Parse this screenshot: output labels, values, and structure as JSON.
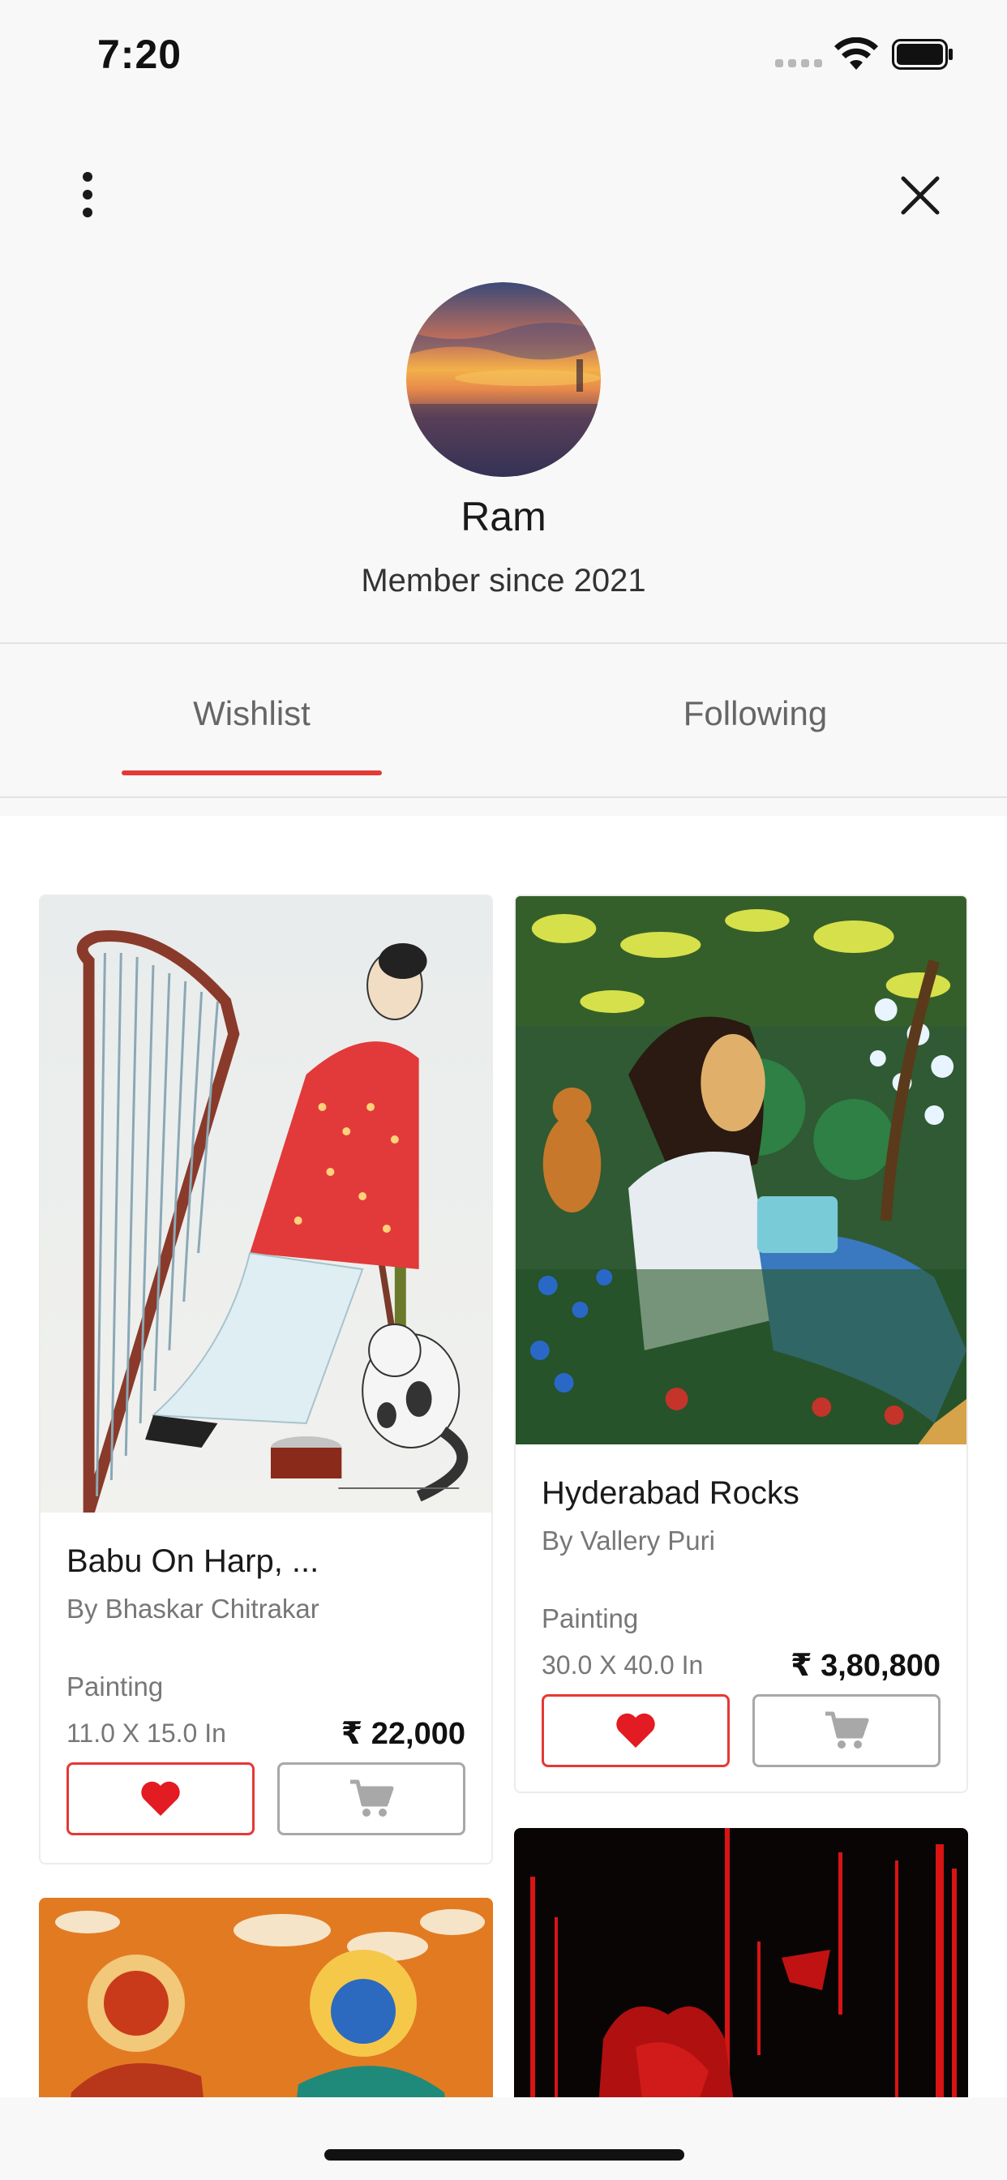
{
  "status_bar": {
    "time": "7:20"
  },
  "profile": {
    "name": "Ram",
    "member_since": "Member since 2021"
  },
  "tabs": [
    {
      "label": "Wishlist",
      "active": true
    },
    {
      "label": "Following",
      "active": false
    }
  ],
  "colors": {
    "accent": "#e53935",
    "muted_text": "#777777",
    "button_border": "#a8a8a8"
  },
  "wishlist": [
    {
      "title": "Babu On Harp, ...",
      "artist": "By Bhaskar Chitrakar",
      "category": "Painting",
      "size": "11.0 X 15.0 In",
      "price": "₹ 22,000",
      "wishlisted": true
    },
    {
      "title": "Hyderabad Rocks",
      "artist": "By Vallery Puri",
      "category": "Painting",
      "size": "30.0 X 40.0 In",
      "price": "₹ 3,80,800",
      "wishlisted": true
    }
  ],
  "icons": {
    "menu": "more-vertical-icon",
    "close": "close-icon",
    "wishlist": "heart-icon",
    "cart": "cart-icon"
  }
}
